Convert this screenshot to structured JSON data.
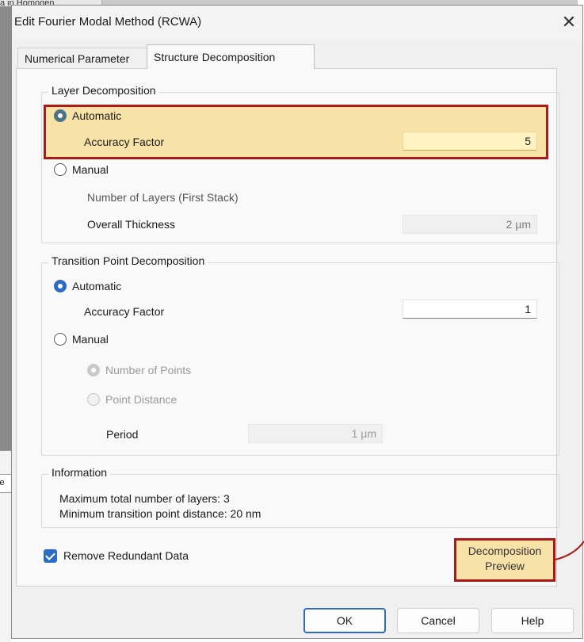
{
  "background": {
    "tab_label": "a in Homogen...",
    "side_label": "ce"
  },
  "dialog": {
    "title": "Edit Fourier Modal Method (RCWA)",
    "close_glyph": "✕"
  },
  "tabs": [
    {
      "label": "Numerical Parameter",
      "active": false
    },
    {
      "label": "Structure Decomposition",
      "active": true
    }
  ],
  "layer_decomposition": {
    "title": "Layer Decomposition",
    "automatic_label": "Automatic",
    "automatic_selected": true,
    "accuracy_label": "Accuracy Factor",
    "accuracy_value": "5",
    "manual_label": "Manual",
    "layers_label": "Number of Layers (First Stack)",
    "thickness_label": "Overall Thickness",
    "thickness_value": "2 µm"
  },
  "transition_decomposition": {
    "title": "Transition Point Decomposition",
    "automatic_label": "Automatic",
    "automatic_selected": true,
    "accuracy_label": "Accuracy Factor",
    "accuracy_value": "1",
    "manual_label": "Manual",
    "points_label": "Number of Points",
    "distance_label": "Point Distance",
    "period_label": "Period",
    "period_value": "1 µm"
  },
  "information": {
    "title": "Information",
    "line1": "Maximum total number of layers: 3",
    "line2": "Minimum transition point distance: 20 nm"
  },
  "remove_redundant": {
    "label": "Remove Redundant Data",
    "checked": true
  },
  "preview_button": {
    "line1": "Decomposition",
    "line2": "Preview"
  },
  "buttons": {
    "ok": "OK",
    "cancel": "Cancel",
    "help": "Help"
  },
  "colors": {
    "accent": "#2b6cc4",
    "highlight_fill": "#f7e3a8",
    "highlight_border": "#b01818"
  }
}
